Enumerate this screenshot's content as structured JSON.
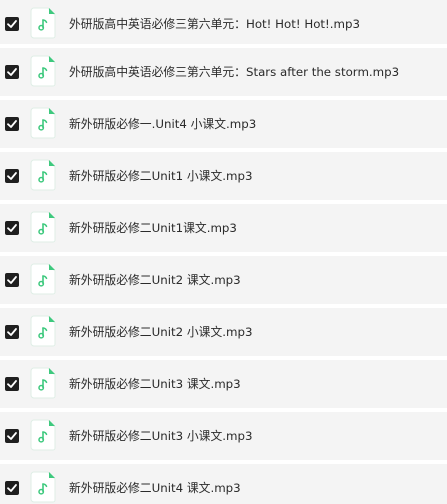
{
  "files": [
    {
      "name": "外研版高中英语必修三第六单元：Hot! Hot! Hot!.mp3",
      "checked": true,
      "icon": "music-note-icon"
    },
    {
      "name": "外研版高中英语必修三第六单元：Stars after the storm.mp3",
      "checked": true,
      "icon": "music-note-icon"
    },
    {
      "name": "新外研版必修一.Unit4 小课文.mp3",
      "checked": true,
      "icon": "music-note-icon"
    },
    {
      "name": "新外研版必修二Unit1 小课文.mp3",
      "checked": true,
      "icon": "music-note-icon"
    },
    {
      "name": "新外研版必修二Unit1课文.mp3",
      "checked": true,
      "icon": "music-note-icon"
    },
    {
      "name": "新外研版必修二Unit2 课文.mp3",
      "checked": true,
      "icon": "music-note-icon"
    },
    {
      "name": "新外研版必修二Unit2 小课文.mp3",
      "checked": true,
      "icon": "music-note-icon"
    },
    {
      "name": "新外研版必修二Unit3 课文.mp3",
      "checked": true,
      "icon": "music-note-icon"
    },
    {
      "name": "新外研版必修二Unit3 小课文.mp3",
      "checked": true,
      "icon": "music-note-icon"
    },
    {
      "name": "新外研版必修二Unit4 课文.mp3",
      "checked": true,
      "icon": "music-note-icon"
    }
  ],
  "colors": {
    "row_background": "#f4f4f4",
    "checkbox": "#1f1f1f",
    "icon_accent": "#3ec97e"
  }
}
